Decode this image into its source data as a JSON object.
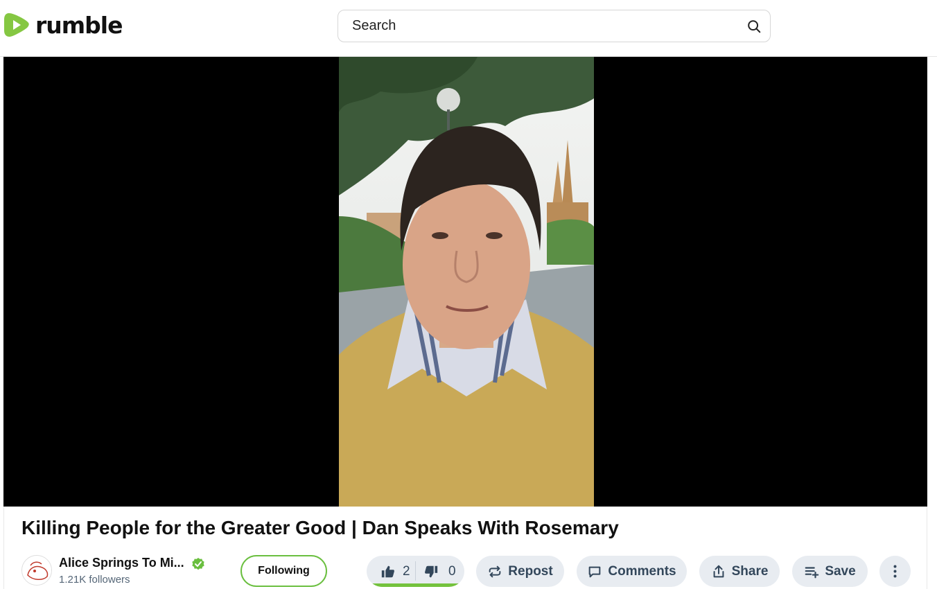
{
  "header": {
    "logo_text": "rumble",
    "search": {
      "placeholder": "Search",
      "value": ""
    }
  },
  "video": {
    "title": "Killing People for the Greater Good | Dan Speaks With Rosemary"
  },
  "channel": {
    "name": "Alice Springs To Mi...",
    "followers": "1.21K followers",
    "verified": true,
    "follow_label": "Following"
  },
  "actions": {
    "likes": "2",
    "dislikes": "0",
    "like_ratio": 1.0,
    "repost_label": "Repost",
    "comments_label": "Comments",
    "share_label": "Share",
    "save_label": "Save"
  },
  "colors": {
    "brand_green": "#85c742",
    "pill_bg": "#e8ecf1",
    "pill_text": "#33475b"
  },
  "icons": [
    "rumble-logo-icon",
    "search-icon",
    "verified-icon",
    "thumbs-up-icon",
    "thumbs-down-icon",
    "repost-icon",
    "comments-icon",
    "share-icon",
    "save-playlist-icon",
    "more-vertical-icon"
  ]
}
